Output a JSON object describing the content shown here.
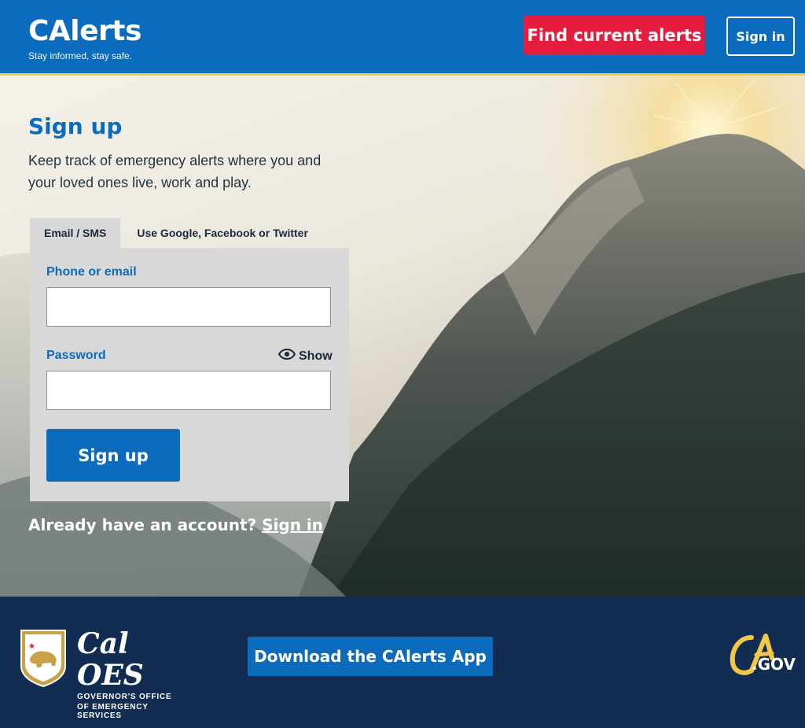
{
  "header": {
    "logo": "CAlerts",
    "tagline": "Stay informed, stay safe.",
    "find_alerts_label": "Find current alerts",
    "signin_label": "Sign in"
  },
  "signup": {
    "title": "Sign up",
    "intro": "Keep track of emergency alerts where you and your loved ones live, work and play.",
    "tabs": [
      {
        "label": "Email / SMS",
        "active": true
      },
      {
        "label": "Use Google, Facebook or Twitter",
        "active": false
      }
    ],
    "phone_email_label": "Phone or email",
    "phone_email_value": "",
    "password_label": "Password",
    "password_value": "",
    "show_label": "Show",
    "submit_label": "Sign up",
    "already_text": "Already have an account?",
    "signin_link": "Sign in"
  },
  "footer": {
    "org_name": "Cal OES",
    "org_sub_line1": "GOVERNOR'S OFFICE",
    "org_sub_line2": "OF EMERGENCY SERVICES",
    "download_label": "Download the CAlerts App",
    "cagov_text": ".GOV"
  },
  "colors": {
    "primary": "#0b6bbd",
    "alert_red": "#e41d3f",
    "accent_gold": "#f2c84b",
    "footer_bg": "#122c52"
  }
}
